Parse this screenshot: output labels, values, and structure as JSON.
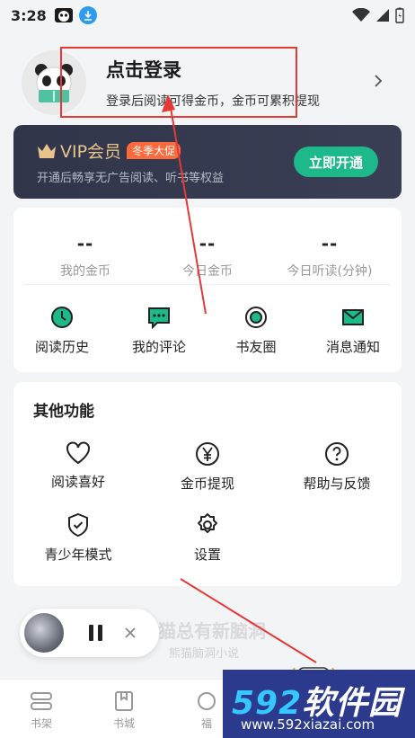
{
  "status_bar": {
    "time": "3:28"
  },
  "profile": {
    "login_title": "点击登录",
    "login_subtitle": "登录后阅读可得金币，金币可累积提现"
  },
  "vip": {
    "title": "VIP会员",
    "badge": "冬季大促",
    "subtitle": "开通后畅享无广告阅读、听书等权益",
    "button": "立即开通"
  },
  "stats": [
    {
      "value": "--",
      "label": "我的金币"
    },
    {
      "value": "--",
      "label": "今日金币"
    },
    {
      "value": "--",
      "label": "今日听读(分钟)"
    }
  ],
  "quick_actions": [
    {
      "label": "阅读历史",
      "icon": "clock-icon"
    },
    {
      "label": "我的评论",
      "icon": "comment-icon"
    },
    {
      "label": "书友圈",
      "icon": "circle-icon"
    },
    {
      "label": "消息通知",
      "icon": "mail-icon"
    }
  ],
  "functions": {
    "title": "其他功能",
    "items": [
      {
        "label": "阅读喜好",
        "icon": "heart-icon"
      },
      {
        "label": "金币提现",
        "icon": "yen-icon"
      },
      {
        "label": "帮助与反馈",
        "icon": "help-icon"
      },
      {
        "label": "青少年模式",
        "icon": "shield-icon"
      },
      {
        "label": "设置",
        "icon": "gear-icon"
      }
    ]
  },
  "promo": {
    "title": "猫总有新脑洞",
    "subtitle": "熊猫脑洞小说"
  },
  "tabs": [
    {
      "label": "书架",
      "icon": "bookshelf-icon"
    },
    {
      "label": "书城",
      "icon": "bookstore-icon"
    },
    {
      "label": "福",
      "icon": "welfare-icon"
    }
  ],
  "watermark": {
    "brand_num": "592",
    "brand_text": "软件园",
    "url": "www.592xiazai.com"
  },
  "colors": {
    "accent": "#1db98a",
    "vip_bg": "#31354a",
    "vip_gold": "#e8c48a",
    "badge": "#ff6a3c",
    "annotation_red": "#e53935"
  }
}
